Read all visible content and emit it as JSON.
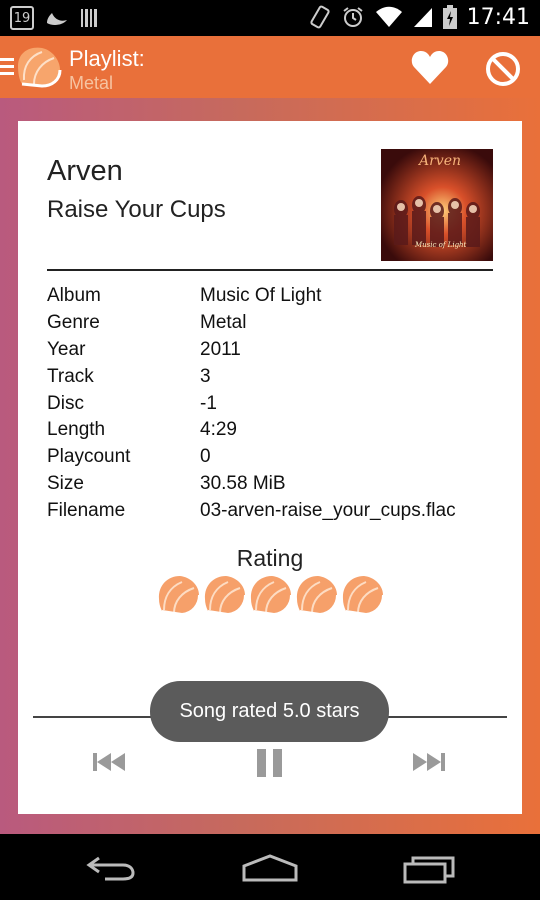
{
  "status_bar": {
    "calendar_day": "19",
    "time": "17:41",
    "icons": [
      "calendar-icon",
      "moon-icon",
      "barcode-icon",
      "vibrate-icon",
      "alarm-icon",
      "wifi-icon",
      "signal-icon",
      "battery-icon"
    ]
  },
  "app_bar": {
    "title": "Playlist:",
    "subtitle": "Metal",
    "accent_color": "#e9703a"
  },
  "song": {
    "artist": "Arven",
    "title": "Raise Your Cups",
    "album_art_title": "Arven",
    "album_art_subtitle": "Music of Light"
  },
  "metadata": [
    {
      "key": "Album",
      "value": "Music Of Light"
    },
    {
      "key": "Genre",
      "value": "Metal"
    },
    {
      "key": "Year",
      "value": "2011"
    },
    {
      "key": "Track",
      "value": "3"
    },
    {
      "key": "Disc",
      "value": "-1"
    },
    {
      "key": "Length",
      "value": "4:29"
    },
    {
      "key": "Playcount",
      "value": "0"
    },
    {
      "key": "Size",
      "value": "30.58 MiB"
    },
    {
      "key": "Filename",
      "value": "03-arven-raise_your_cups.flac"
    }
  ],
  "rating": {
    "label": "Rating",
    "stars": 5,
    "max_stars": 5
  },
  "toast": "Song rated 5.0 stars"
}
